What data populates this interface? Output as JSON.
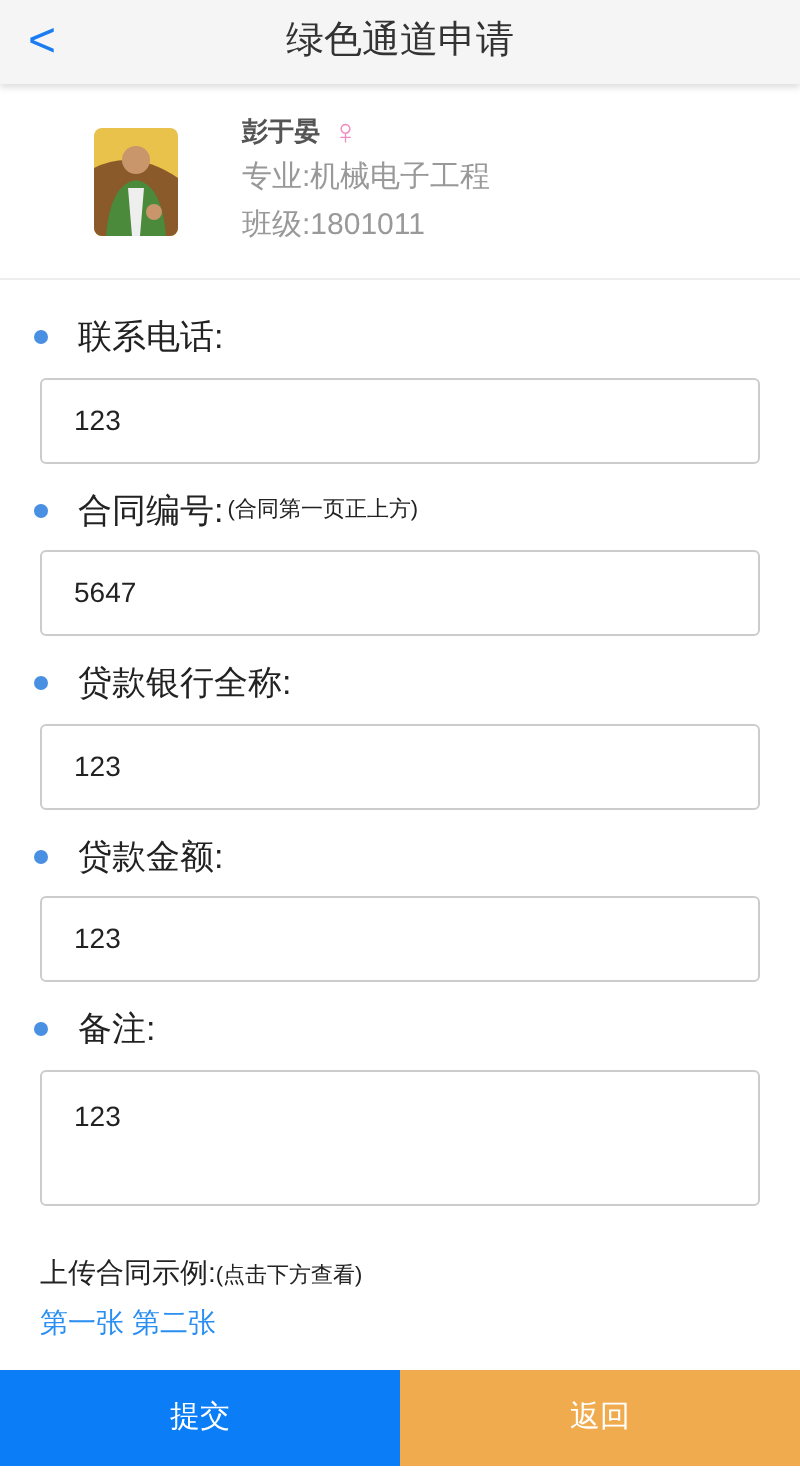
{
  "header": {
    "back": "<",
    "title": "绿色通道申请"
  },
  "profile": {
    "name": "彭于晏",
    "gender": "♀",
    "major": "专业:机械电子工程",
    "class": "班级:1801011"
  },
  "fields": [
    {
      "kind": "input",
      "label": "联系电话:",
      "value": "123"
    },
    {
      "kind": "input",
      "label": "合同编号:",
      "hint": "(合同第一页正上方)",
      "value": "5647"
    },
    {
      "kind": "input",
      "label": "贷款银行全称:",
      "value": "123"
    },
    {
      "kind": "input",
      "label": "贷款金额:",
      "value": "123"
    },
    {
      "kind": "textarea",
      "label": "备注:",
      "value": "123"
    }
  ],
  "example": {
    "label": "上传合同示例:",
    "hint": "(点击下方查看)",
    "links": [
      "第一张",
      "第二张"
    ]
  },
  "buttons": [
    {
      "kind": "primary",
      "label": "提交"
    },
    {
      "kind": "secondary",
      "label": "返回"
    }
  ]
}
